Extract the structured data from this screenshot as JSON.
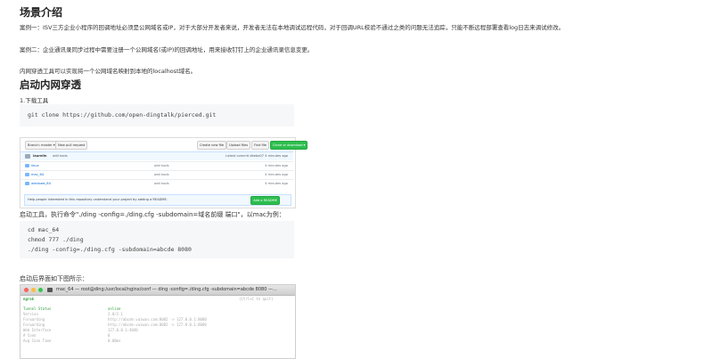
{
  "section1": {
    "title": "场景介绍",
    "case1": "案例一：ISV三方企业小程序的回调地址必须是公网域名或IP，对于大部分开发者来说，开发者无法在本地调试远程代码，对于回调URL校验不通过之类的问题无法追踪，只能不断远程部署查看log日志来调试修改。",
    "case2": "案例二：企业通讯录同步过程中需要注册一个公网域名(或IP)的回调地址，用来接收钉钉上的企业通讯录信息变更。",
    "note": "内网穿透工具可以实现将一个公网域名映射到本地的localhost域名。"
  },
  "section2": {
    "title": "启动内网穿透",
    "step1": "1.下载工具",
    "clone_cmd": "git clone https://github.com/open-dingtalk/pierced.git",
    "github": {
      "branch_btn": "Branch: master ▾",
      "pull_btn": "New pull request",
      "create_btn": "Create new file",
      "upload_btn": "Upload files",
      "find_btn": "Find file",
      "clone_btn": "Clone or download ▾",
      "commit_user": "laurelin",
      "commit_msg": "add tools",
      "commit_time": "Latest commit dbeba07 4 minutes ago",
      "rows": [
        {
          "name": "linux",
          "commit": "add tools",
          "age": "4 minutes ago"
        },
        {
          "name": "mac_64",
          "commit": "add tools",
          "age": "4 minutes ago"
        },
        {
          "name": "windows_64",
          "commit": "add tools",
          "age": "4 minutes ago"
        }
      ],
      "readme_text": "Help people interested in this repository understand your project by adding a README.",
      "readme_btn": "Add a README"
    },
    "step2": "启动工具，执行命令\"./ding -config=./ding.cfg -subdomain=域名前缀 端口\"，以mac为例：",
    "cmds": [
      "cd mac_64",
      "chmod 777 ./ding",
      "./ding -config=./ding.cfg -subdomain=abcde 8080"
    ],
    "step3": "启动后界面如下图所示：",
    "terminal": {
      "title": "mac_64 — root@ding:/usr/local/nginx/conf — ding -config=./ding.cfg -subdomain=abcde 8080 —...",
      "app": "ngrok",
      "quit": "(Ctrl+C to quit)",
      "rows": [
        {
          "k": "Tunnel Status",
          "v": "online"
        },
        {
          "k": "Version",
          "v": "2.0/2.1"
        },
        {
          "k": "Forwarding",
          "v": "http://abcde.vaiwan.com:8082 -> 127.0.0.1:8080"
        },
        {
          "k": "Forwarding",
          "v": "http://abcde.vaiwan.com:8082 -> 127.0.0.1:8080"
        },
        {
          "k": "Web Interface",
          "v": "127.0.0.1:4040"
        },
        {
          "k": "# Conn",
          "v": "0"
        },
        {
          "k": "Avg Conn Time",
          "v": "0.00ms"
        }
      ],
      "colors": {
        "red": "#fc605b",
        "yellow": "#fdbc40",
        "green": "#34c84a",
        "status": "#2e9e3a"
      }
    }
  }
}
